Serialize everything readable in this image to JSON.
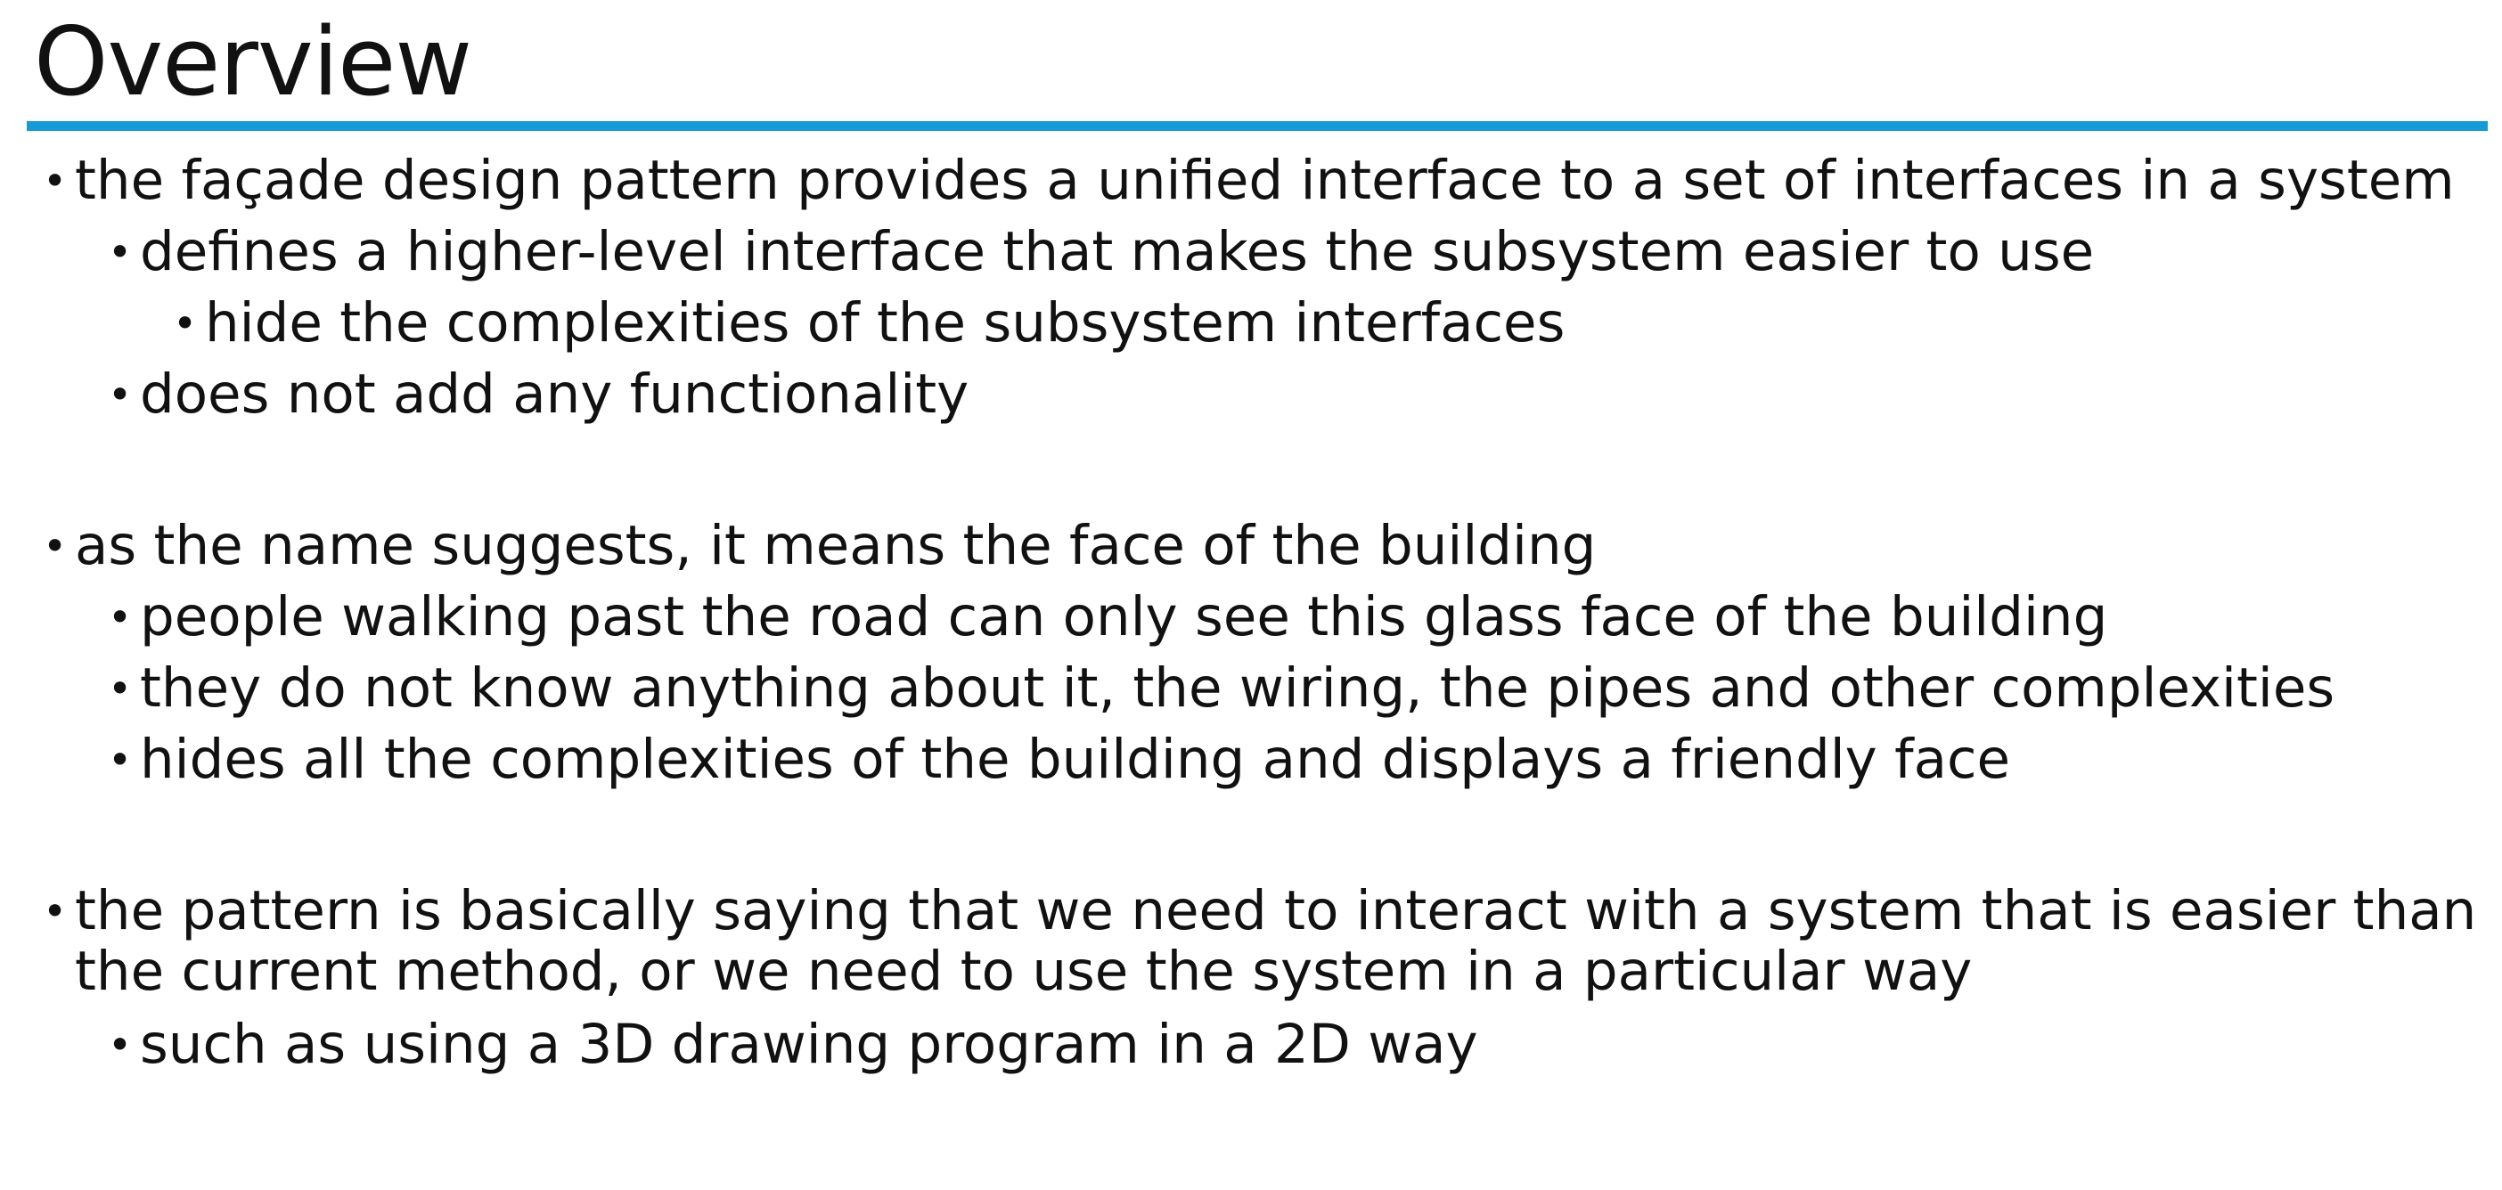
{
  "slide": {
    "title": "Overview",
    "accent_color": "#169ad6",
    "bullets": [
      {
        "text": "the façade design pattern provides a unified interface to a set of interfaces in a system"
      },
      {
        "text": "defines a higher-level interface that makes the subsystem easier to use"
      },
      {
        "text": "hide the complexities of the subsystem interfaces"
      },
      {
        "text": "does not add any functionality"
      },
      {
        "text": "as the name suggests, it means the face of the building"
      },
      {
        "text": "people walking past the road can only see this glass face of the building"
      },
      {
        "text": "they do not know anything about it, the wiring, the pipes and other complexities"
      },
      {
        "text": "hides all the complexities of the building and displays a friendly face"
      },
      {
        "text": "the pattern is basically saying that we need to interact with a system that is easier than",
        "continuation": "the current method, or we need to use the system in a particular way"
      },
      {
        "text": "such as using a 3D drawing program in a 2D way"
      }
    ]
  }
}
